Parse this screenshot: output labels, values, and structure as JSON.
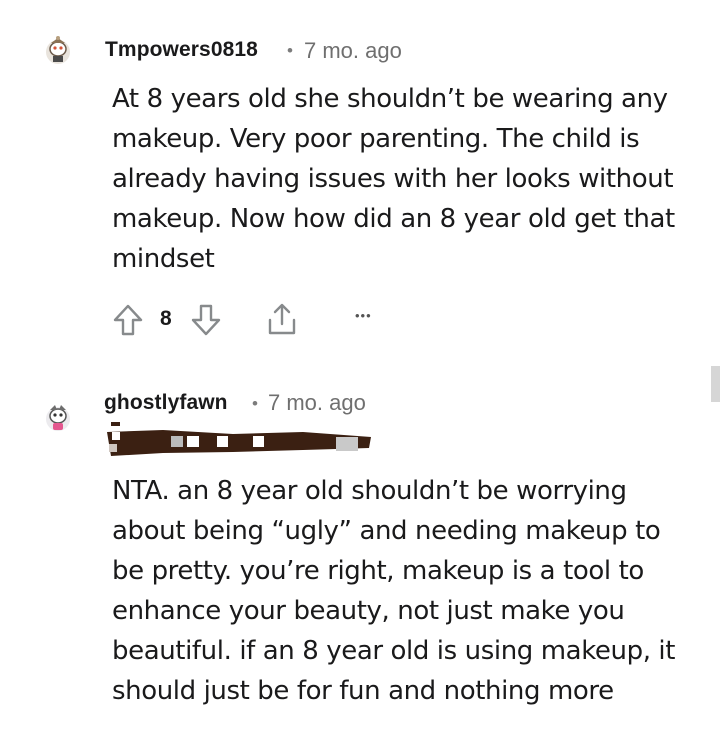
{
  "comments": [
    {
      "username": "Tmpowers0818",
      "separator": "•",
      "time": "7 mo. ago",
      "body_lines": [
        "At 8 years old she shouldn’t be wearing any",
        "makeup. Very poor parenting. The child is",
        "already having issues with her looks without",
        "makeup. Now how did an 8 year old get that",
        "mindset"
      ],
      "vote_count": "8",
      "more_label": "•••"
    },
    {
      "username": "ghostlyfawn",
      "separator": "•",
      "time": "7 mo. ago",
      "body_lines": [
        "NTA. an 8 year old shouldn’t be worrying",
        "about being “ugly” and needing makeup to",
        "be pretty. you’re right, makeup is a tool to",
        "enhance your beauty, not just make you",
        "beautiful. if an 8 year old is using makeup, it",
        "should just be for fun and nothing more"
      ]
    }
  ],
  "icons": {
    "upvote": "arrow-up-icon",
    "downvote": "arrow-down-icon",
    "share": "share-icon",
    "more": "more-icon",
    "avatar": "snoo-avatar-icon"
  },
  "colors": {
    "text": "#1a1a1b",
    "meta": "#6f6f6f",
    "icon": "#878a8c"
  }
}
